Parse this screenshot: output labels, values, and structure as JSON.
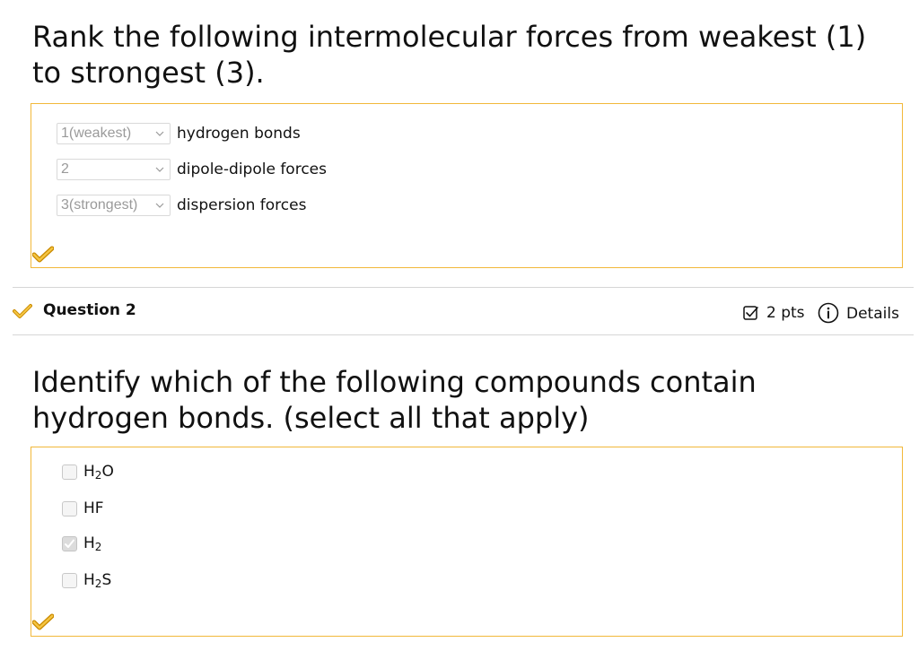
{
  "question1": {
    "prompt": "Rank the following intermolecular forces from weakest (1) to strongest (3).",
    "rows": [
      {
        "selected": "1(weakest)",
        "label": "hydrogen bonds"
      },
      {
        "selected": "2",
        "label": "dipole-dipole forces"
      },
      {
        "selected": "3(strongest)",
        "label": "dispersion forces"
      }
    ]
  },
  "question2": {
    "title": "Question 2",
    "points": "2 pts",
    "details": "Details",
    "prompt": "Identify which of the following compounds contain hydrogen bonds. (select all that apply)",
    "options": [
      {
        "base": "H",
        "sub": "2",
        "tail": "O",
        "checked": false
      },
      {
        "base": "HF",
        "sub": "",
        "tail": "",
        "checked": false
      },
      {
        "base": "H",
        "sub": "2",
        "tail": "",
        "checked": true
      },
      {
        "base": "H",
        "sub": "2",
        "tail": "S",
        "checked": false
      }
    ]
  },
  "colors": {
    "accent_border": "#f2b83a",
    "correct_mark": "#f0a800",
    "select_text": "#9a9a9a"
  },
  "icons": {
    "correct": "correct-check-icon",
    "points": "checkbox-pts-icon",
    "info": "info-icon",
    "dropdown": "chevron-down-icon"
  }
}
